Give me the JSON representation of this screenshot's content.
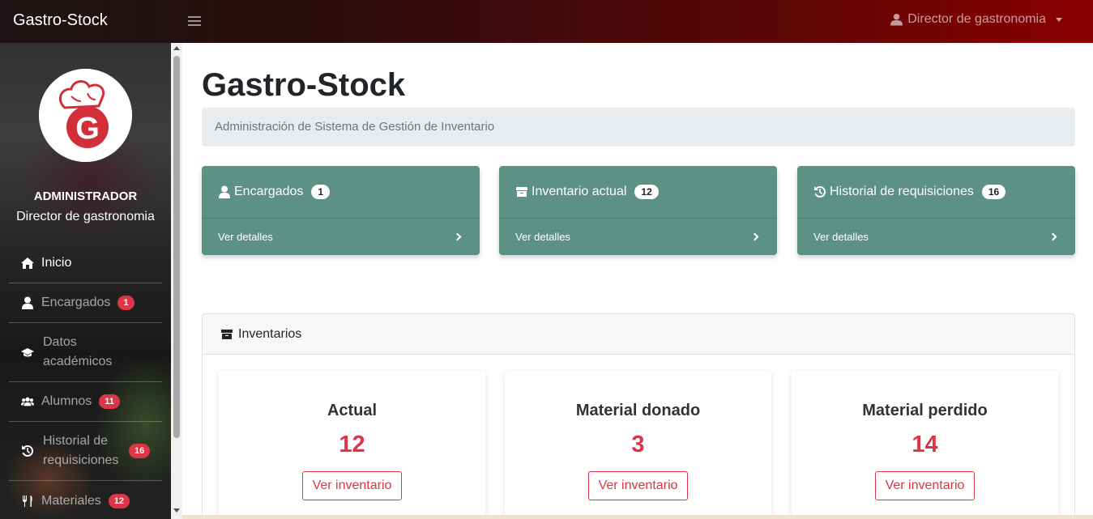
{
  "navbar": {
    "brand": "Gastro-Stock",
    "user": "Director de gastronomia"
  },
  "sidebar": {
    "role_title": "ADMINISTRADOR",
    "role_subtitle": "Director de gastronomia",
    "items": [
      {
        "label": "Inicio",
        "icon": "home-icon",
        "badge": ""
      },
      {
        "label": "Encargados",
        "icon": "user-icon",
        "badge": "1"
      },
      {
        "label": "Datos académicos",
        "icon": "graduation-cap-icon",
        "badge": ""
      },
      {
        "label": "Alumnos",
        "icon": "users-icon",
        "badge": "11"
      },
      {
        "label": "Historial de requisiciones",
        "icon": "history-icon",
        "badge": "16"
      },
      {
        "label": "Materiales",
        "icon": "utensils-icon",
        "badge": "12"
      }
    ]
  },
  "main": {
    "title": "Gastro-Stock",
    "breadcrumb": "Administración de Sistema de Gestión de Inventario",
    "cards": [
      {
        "label": "Encargados",
        "badge": "1",
        "link": "Ver detalles",
        "icon": "user-icon"
      },
      {
        "label": "Inventario actual",
        "badge": "12",
        "link": "Ver detalles",
        "icon": "archive-icon"
      },
      {
        "label": "Historial de requisiciones",
        "badge": "16",
        "link": "Ver detalles",
        "icon": "history-icon"
      }
    ],
    "inventory_panel": {
      "title": "Inventarios",
      "items": [
        {
          "title": "Actual",
          "count": "12",
          "button": "Ver inventario"
        },
        {
          "title": "Material donado",
          "count": "3",
          "button": "Ver inventario"
        },
        {
          "title": "Material perdido",
          "count": "14",
          "button": "Ver inventario"
        }
      ]
    }
  },
  "colors": {
    "card_bg": "#5d9184",
    "accent_red": "#dc3545",
    "navbar_end": "#8a0000"
  }
}
